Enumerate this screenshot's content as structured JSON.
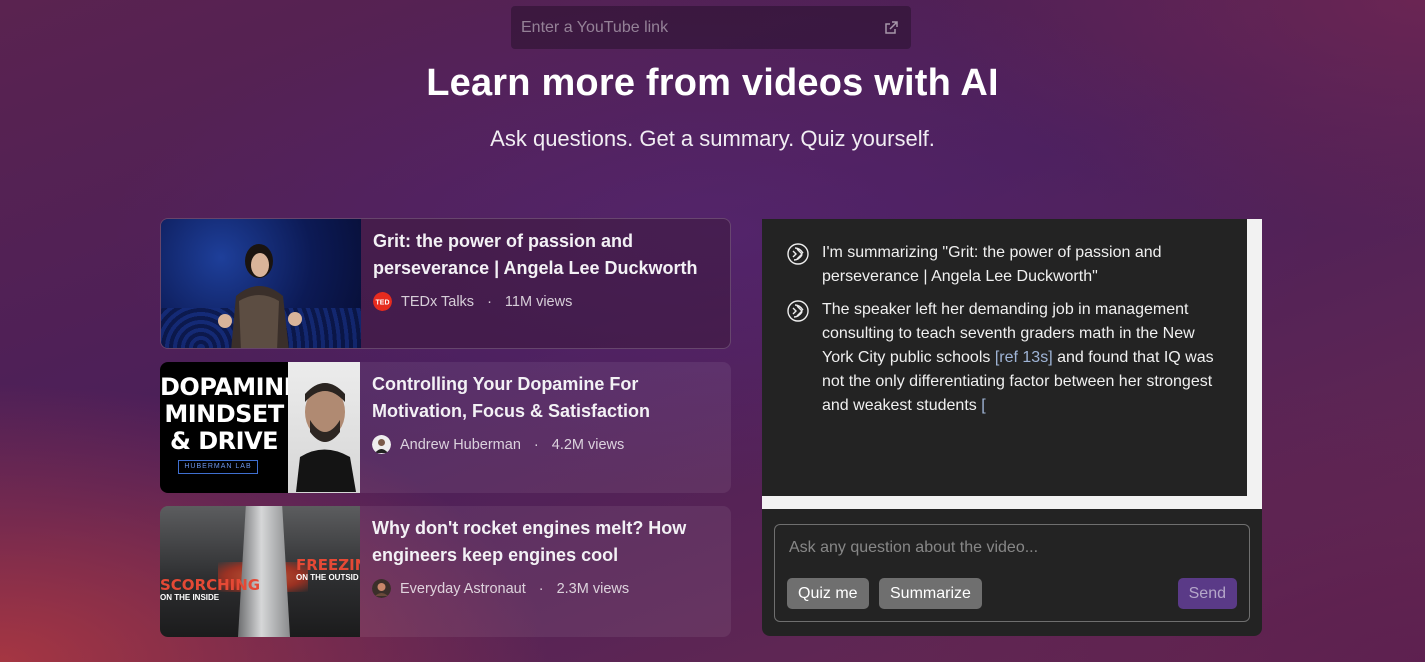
{
  "search": {
    "placeholder": "Enter a YouTube link",
    "icon": "external-link-icon"
  },
  "hero": {
    "title": "Learn more from videos with AI",
    "subtitle": "Ask questions. Get a summary. Quiz yourself."
  },
  "videos": [
    {
      "title": "Grit: the power of passion and perseverance | Angela Lee Duckworth",
      "channel": "TEDx Talks",
      "views": "11M views",
      "channel_icon": "ted-logo-icon",
      "active": true
    },
    {
      "title": "Controlling Your Dopamine For Motivation, Focus & Satisfaction",
      "channel": "Andrew Huberman",
      "views": "4.2M views",
      "channel_icon": "avatar-icon",
      "thumb_text": [
        "DOPAMINE",
        "MINDSET",
        "& DRIVE"
      ],
      "thumb_badge": "HUBERMAN LAB"
    },
    {
      "title": "Why don't rocket engines melt? How engineers keep engines cool",
      "channel": "Everyday Astronaut",
      "views": "2.3M views",
      "channel_icon": "avatar-icon",
      "thumb_left": "SCORCHING",
      "thumb_left_sub": "ON THE INSIDE",
      "thumb_right": "FREEZIN",
      "thumb_right_sub": "ON THE OUTSID"
    }
  ],
  "chat": {
    "messages": [
      {
        "text": "I'm summarizing \"Grit: the power of passion and perseverance | Angela Lee Duckworth\""
      },
      {
        "text_before": "The speaker left her demanding job in management consulting to teach seventh graders math in the New York City public schools ",
        "ref": "[ref 13s]",
        "text_after": " and found that IQ was not the only differentiating factor between her strongest and weakest students ",
        "ref_partial": "["
      }
    ],
    "input_placeholder": "Ask any question about the video...",
    "quiz_label": "Quiz me",
    "summarize_label": "Summarize",
    "send_label": "Send"
  },
  "colors": {
    "send_button": "#5a3a87",
    "ref_link": "#9fb4d6",
    "panel": "#232323"
  }
}
